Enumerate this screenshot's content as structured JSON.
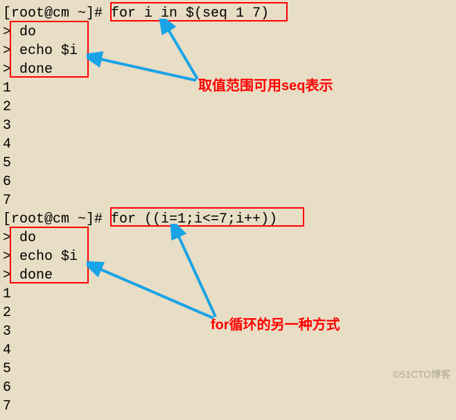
{
  "terminal": {
    "block1": {
      "prompt": "[root@cm ~]#",
      "cmd": " for i in $(seq 1 7)",
      "cont1": "> do",
      "cont2": "> echo $i",
      "cont3": "> done",
      "out": [
        "1",
        "2",
        "3",
        "4",
        "5",
        "6",
        "7"
      ]
    },
    "block2": {
      "prompt": "[root@cm ~]#",
      "cmd": " for ((i=1;i<=7;i++))",
      "cont1": "> do",
      "cont2": "> echo $i",
      "cont3": "> done",
      "out": [
        "1",
        "2",
        "3",
        "4",
        "5",
        "6",
        "7"
      ]
    }
  },
  "annotations": {
    "a1": "取值范围可用seq表示",
    "a2": "for循环的另一种方式"
  },
  "watermark": "©51CTO博客"
}
